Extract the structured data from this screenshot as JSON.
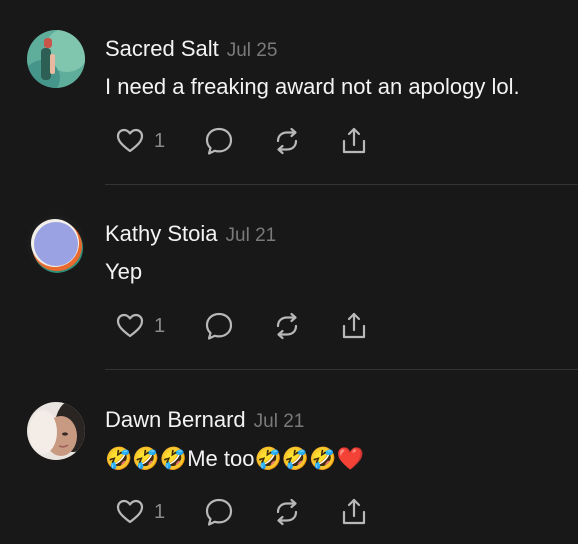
{
  "comments": [
    {
      "author": "Sacred Salt",
      "date": "Jul 25",
      "text": "I need a freaking award not an apology lol.",
      "likes": "1"
    },
    {
      "author": "Kathy Stoia",
      "date": "Jul 21",
      "text": "Yep",
      "likes": "1"
    },
    {
      "author": "Dawn Bernard",
      "date": "Jul 21",
      "text_before": "🤣🤣🤣",
      "text_mid": "Me too",
      "text_after": "🤣🤣🤣❤️",
      "likes": "1"
    }
  ],
  "icons": {
    "like": "heart-icon",
    "reply": "comment-bubble-icon",
    "repost": "repost-icon",
    "share": "share-icon"
  },
  "colors": {
    "background": "#181818",
    "text": "#f3f3f3",
    "muted": "#7a7a7a",
    "icon": "#b8b8b8",
    "heart": "#e8233a"
  }
}
